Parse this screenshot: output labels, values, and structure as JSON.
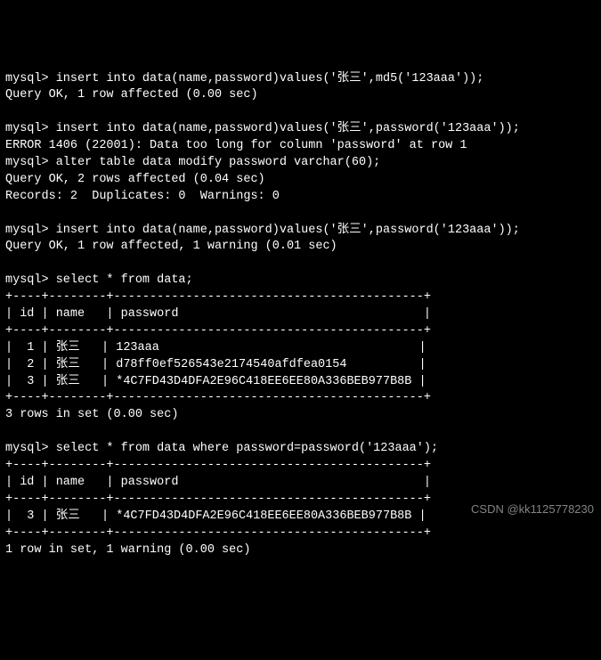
{
  "lines": [
    "mysql> insert into data(name,password)values('张三',md5('123aaa'));",
    "Query OK, 1 row affected (0.00 sec)",
    "",
    "mysql> insert into data(name,password)values('张三',password('123aaa'));",
    "ERROR 1406 (22001): Data too long for column 'password' at row 1",
    "mysql> alter table data modify password varchar(60);",
    "Query OK, 2 rows affected (0.04 sec)",
    "Records: 2  Duplicates: 0  Warnings: 0",
    "",
    "mysql> insert into data(name,password)values('张三',password('123aaa'));",
    "Query OK, 1 row affected, 1 warning (0.01 sec)",
    "",
    "mysql> select * from data;",
    "+----+--------+-------------------------------------------+",
    "| id | name   | password                                  |",
    "+----+--------+-------------------------------------------+",
    "|  1 | 张三   | 123aaa                                    |",
    "|  2 | 张三   | d78ff0ef526543e2174540afdfea0154          |",
    "|  3 | 张三   | *4C7FD43D4DFA2E96C418EE6EE80A336BEB977B8B |",
    "+----+--------+-------------------------------------------+",
    "3 rows in set (0.00 sec)",
    "",
    "mysql> select * from data where password=password('123aaa');",
    "+----+--------+-------------------------------------------+",
    "| id | name   | password                                  |",
    "+----+--------+-------------------------------------------+",
    "|  3 | 张三   | *4C7FD43D4DFA2E96C418EE6EE80A336BEB977B8B |",
    "+----+--------+-------------------------------------------+",
    "1 row in set, 1 warning (0.00 sec)"
  ],
  "watermark": "CSDN @kk1125778230"
}
